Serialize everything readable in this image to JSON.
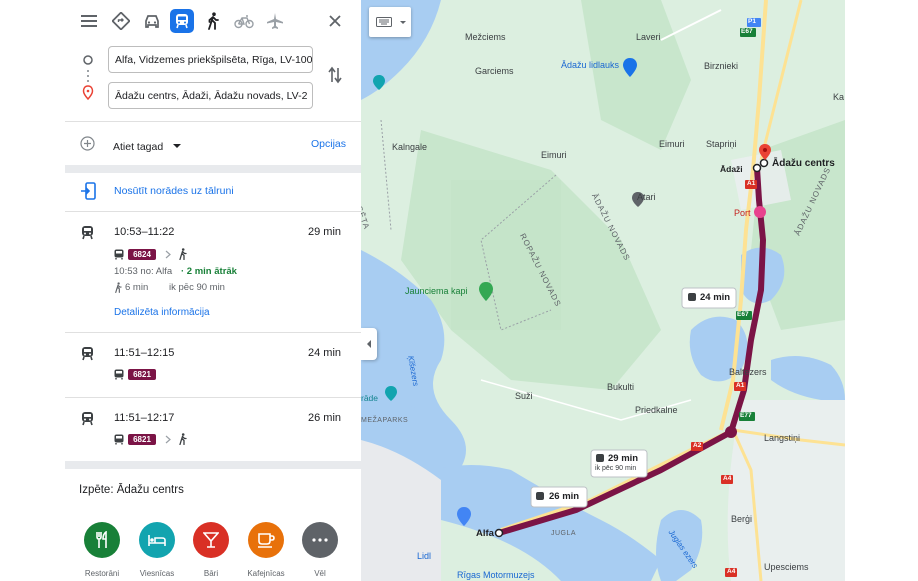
{
  "colors": {
    "accent": "#1a73e8",
    "route": "#7b1446",
    "eta_green": "#188038",
    "map_land": "#d3ead7",
    "map_water": "#a7cdf2"
  },
  "modes": [
    {
      "name": "best-route-icon"
    },
    {
      "name": "car-icon"
    },
    {
      "name": "transit-icon",
      "active": true
    },
    {
      "name": "walk-icon"
    },
    {
      "name": "bike-icon"
    },
    {
      "name": "flight-icon"
    }
  ],
  "origin": {
    "value": "Alfa, Vidzemes priekšpilsēta, Rīga, LV-100"
  },
  "destination": {
    "value": "Ādažu centrs, Ādaži, Ādažu novads, LV-2"
  },
  "depart": {
    "label": "Atiet tagad",
    "options_label": "Opcijas"
  },
  "send": {
    "label": "Nosūtīt norādes uz tālruni"
  },
  "routes": [
    {
      "time": "10:53–11:22",
      "duration": "29 min",
      "bus": "6824",
      "detail_time": "10:53 no: Alfa",
      "detail_early": "· 2 min ātrāk",
      "walk": "6 min",
      "frequency": "ik pēc 90 min",
      "details_link": "Detalizēta informācija"
    },
    {
      "time": "11:51–12:15",
      "duration": "24 min",
      "bus": "6821"
    },
    {
      "time": "11:51–12:17",
      "duration": "26 min",
      "bus": "6821"
    }
  ],
  "explore": {
    "title": "Izpēte: Ādažu centrs",
    "categories": [
      "Restorāni",
      "Viesnīcas",
      "Bāri",
      "Kafejnīcas",
      "Vēl"
    ]
  },
  "map": {
    "labels": {
      "mezciems": "Mežciems",
      "laveri": "Laveri",
      "garciems": "Garciems",
      "adazu_lidlauks": "Ādažu lidlauks",
      "birznieki": "Birznieki",
      "ka": "Ka",
      "kalngale": "Kalngale",
      "eimuri1": "Eimuri",
      "eimuri2": "Eimuri",
      "stapnini": "Stapriņi",
      "adazi": "Ādaži",
      "adazu_centrs": "Ādažu centrs",
      "atari": "Atari",
      "port": "Port",
      "ropazu_novads": "ROPAŽU NOVADS",
      "adazu_novads": "ĀDAŽU NOVADS",
      "adazu_novads2": "ĀDAŽU NOVADS",
      "seta": "SĒTA",
      "jaunciema_kapi": "Jaunciema kapi",
      "kisezers": "Ķīšezers",
      "bukulti": "Bukulti",
      "baltezers": "Baltezers",
      "suzi": "Suži",
      "priedkalne": "Priedkalne",
      "langstini": "Langstiņi",
      "rade": "rāde",
      "mezaparks": "MEŽAPARKS",
      "bergi": "Berģi",
      "alfa": "Alfa",
      "jugla": "JUGLA",
      "lidl": "Lidl",
      "upesciems": "Upesciems",
      "juglas_ezers": "Juglas ezers",
      "rigas_motormuzejs": "Rīgas Motormuzejs"
    },
    "roads": {
      "p1": "P1",
      "e67a": "E67",
      "a1a": "A1",
      "e67b": "E67",
      "a1b": "A1",
      "e77": "E77",
      "a2": "A2",
      "a4a": "A4",
      "a4b": "A4"
    },
    "callouts": {
      "r1_time": "29 min",
      "r1_freq": "ik pēc 90 min",
      "r2": "24 min",
      "r3": "26 min"
    }
  }
}
